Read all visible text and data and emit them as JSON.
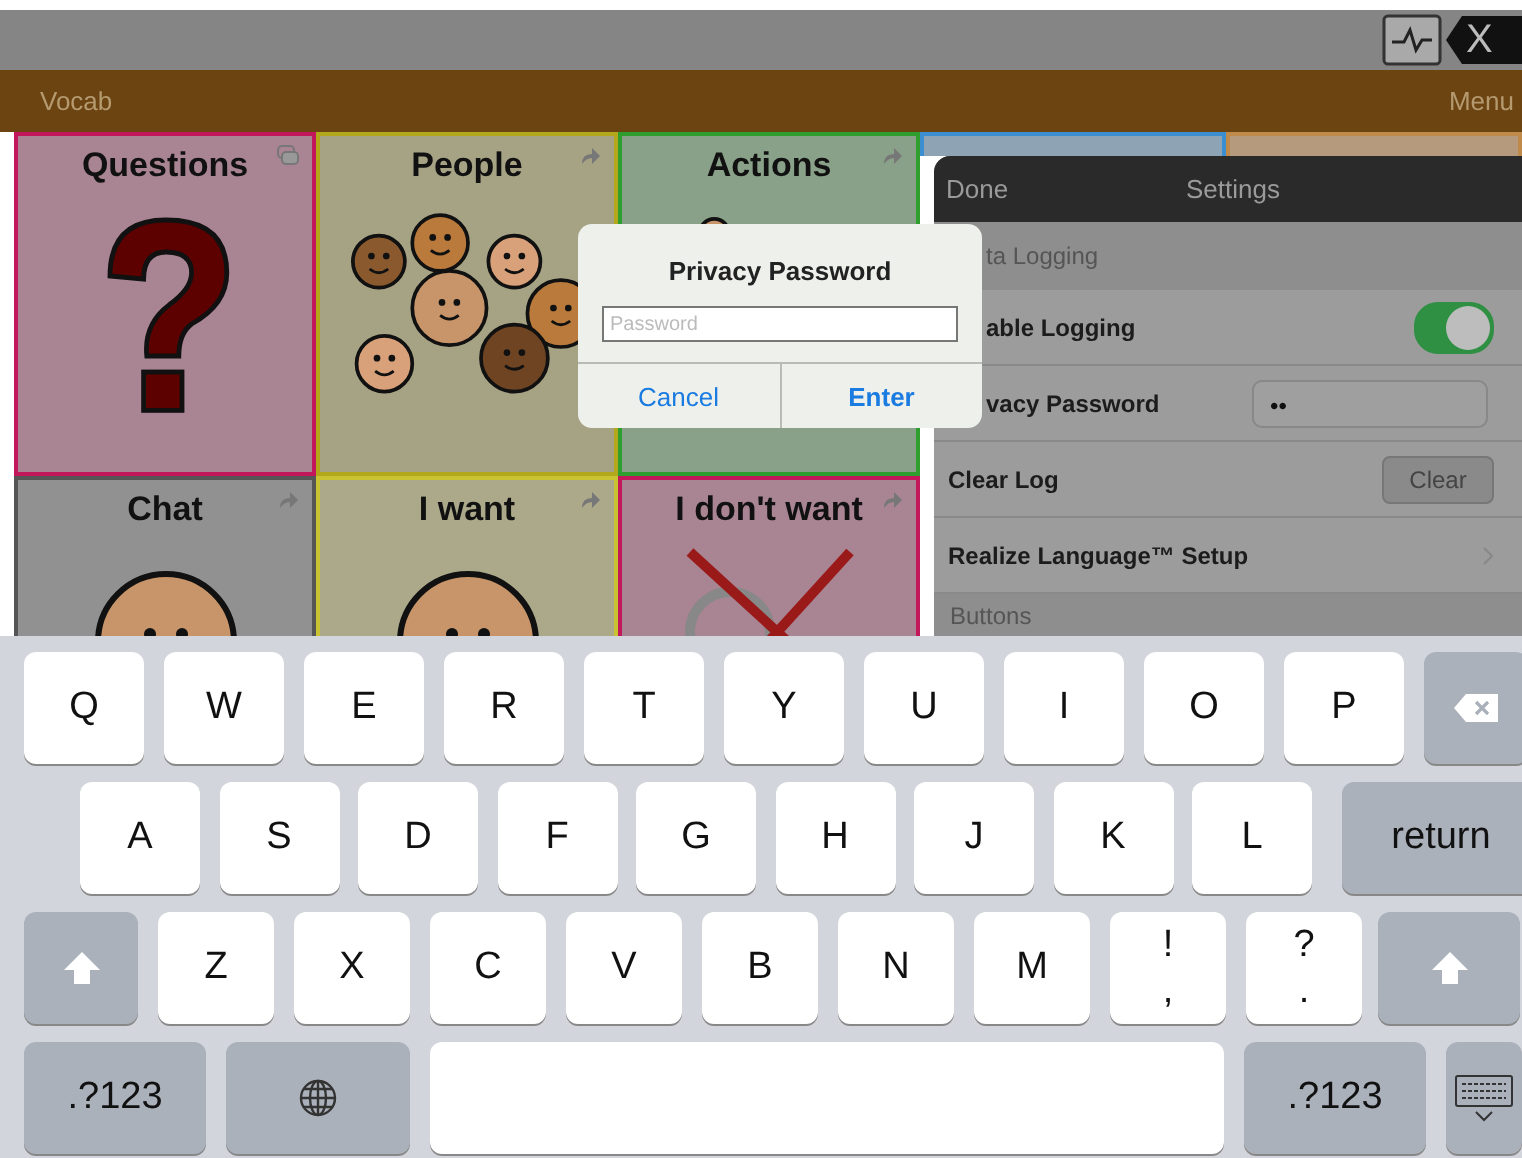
{
  "top_bar": {
    "clear_label": "X"
  },
  "nav_bar": {
    "left": "Vocab",
    "right": "Menu"
  },
  "tiles": [
    {
      "label": "Questions",
      "color": "#c2185b",
      "kind": "question"
    },
    {
      "label": "People",
      "color": "#b3a81c",
      "kind": "faces"
    },
    {
      "label": "Actions",
      "color": "#2e9e2e",
      "kind": "person"
    },
    {
      "label": "Chat",
      "color": "#555555",
      "kind": "face"
    },
    {
      "label": "I want",
      "color": "#c9c233",
      "kind": "face"
    },
    {
      "label": "I don't want",
      "color": "#c2185b",
      "kind": "cross"
    }
  ],
  "settings": {
    "done": "Done",
    "title": "Settings",
    "rows": [
      {
        "kind": "section",
        "label": "ta Logging"
      },
      {
        "kind": "toggle",
        "label": "able Logging",
        "on": true
      },
      {
        "kind": "password",
        "label": "vacy Password",
        "value": "••"
      },
      {
        "kind": "button",
        "label": "Clear Log",
        "button": "Clear"
      },
      {
        "kind": "link",
        "label": "Realize Language™ Setup"
      },
      {
        "kind": "section",
        "label": "Buttons"
      }
    ]
  },
  "dialog": {
    "title": "Privacy Password",
    "placeholder": "Password",
    "cancel": "Cancel",
    "enter": "Enter"
  },
  "keyboard": {
    "rows": [
      {
        "keys": [
          {
            "kind": "char",
            "label": "Q"
          },
          {
            "kind": "char",
            "label": "W"
          },
          {
            "kind": "char",
            "label": "E"
          },
          {
            "kind": "char",
            "label": "R"
          },
          {
            "kind": "char",
            "label": "T"
          },
          {
            "kind": "char",
            "label": "Y"
          },
          {
            "kind": "char",
            "label": "U"
          },
          {
            "kind": "char",
            "label": "I"
          },
          {
            "kind": "char",
            "label": "O"
          },
          {
            "kind": "char",
            "label": "P"
          },
          {
            "kind": "backspace"
          }
        ]
      },
      {
        "keys": [
          {
            "kind": "char",
            "label": "A"
          },
          {
            "kind": "char",
            "label": "S"
          },
          {
            "kind": "char",
            "label": "D"
          },
          {
            "kind": "char",
            "label": "F"
          },
          {
            "kind": "char",
            "label": "G"
          },
          {
            "kind": "char",
            "label": "H"
          },
          {
            "kind": "char",
            "label": "J"
          },
          {
            "kind": "char",
            "label": "K"
          },
          {
            "kind": "char",
            "label": "L"
          },
          {
            "kind": "return",
            "label": "return"
          }
        ]
      },
      {
        "keys": [
          {
            "kind": "shift"
          },
          {
            "kind": "char",
            "label": "Z"
          },
          {
            "kind": "char",
            "label": "X"
          },
          {
            "kind": "char",
            "label": "C"
          },
          {
            "kind": "char",
            "label": "V"
          },
          {
            "kind": "char",
            "label": "B"
          },
          {
            "kind": "char",
            "label": "N"
          },
          {
            "kind": "char",
            "label": "M"
          },
          {
            "kind": "punct",
            "label": "!",
            "sub": ","
          },
          {
            "kind": "punct",
            "label": "?",
            "sub": "."
          },
          {
            "kind": "shift"
          }
        ]
      },
      {
        "keys": [
          {
            "kind": "mode",
            "label": ".?123"
          },
          {
            "kind": "globe"
          },
          {
            "kind": "space"
          },
          {
            "kind": "mode",
            "label": ".?123"
          },
          {
            "kind": "hide"
          }
        ]
      }
    ]
  }
}
